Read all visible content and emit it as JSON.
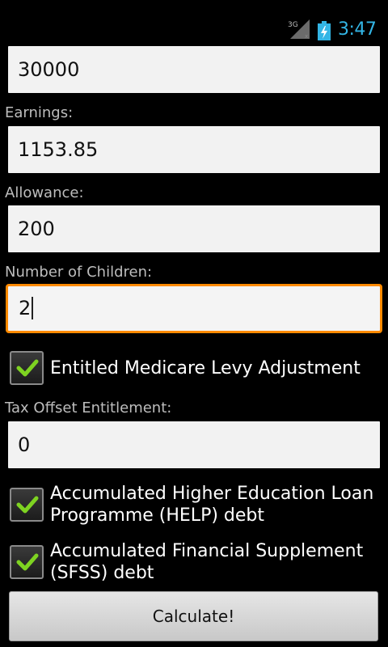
{
  "status_bar": {
    "network_label": "3G",
    "time": "3:47"
  },
  "form": {
    "income_value": "30000",
    "earnings_label": "Earnings:",
    "earnings_value": "1153.85",
    "allowance_label": "Allowance:",
    "allowance_value": "200",
    "children_label": "Number of Children:",
    "children_value": "2",
    "medicare_label": "Entitled Medicare Levy Adjustment",
    "medicare_checked": true,
    "tax_offset_label": "Tax Offset Entitlement:",
    "tax_offset_value": "0",
    "help_label_line1": "Accumulated Higher Education Loan",
    "help_label_line2": "Programme (HELP) debt",
    "help_checked": true,
    "sfss_label_line1": "Accumulated Financial Supplement",
    "sfss_label_line2": "(SFSS) debt",
    "sfss_checked": true,
    "calculate_label": "Calculate!"
  },
  "colors": {
    "focus_border": "#ff8a00",
    "check_mark": "#7ed321",
    "clock": "#33b5e5"
  }
}
